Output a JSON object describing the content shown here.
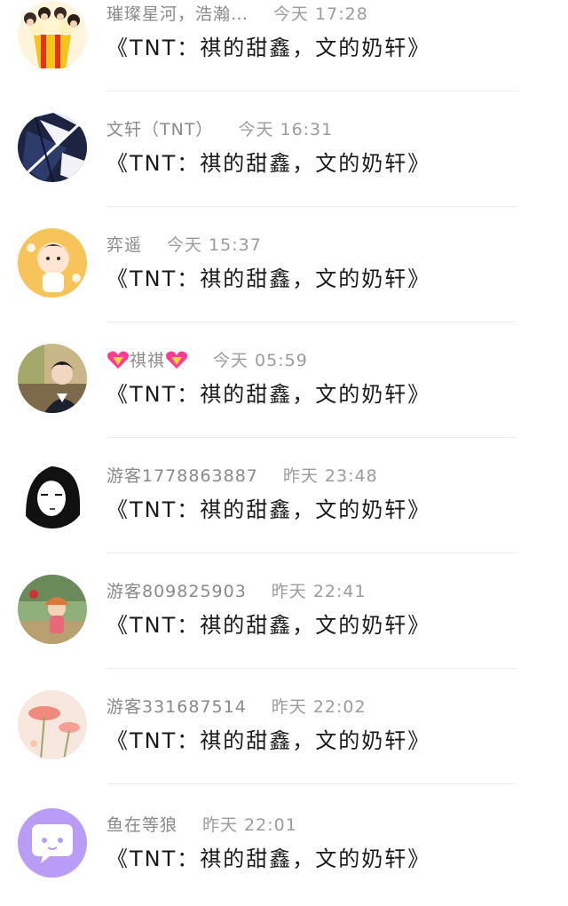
{
  "comments": [
    {
      "name": "璀璨星河，浩瀚…",
      "time": "今天 17:28",
      "text": "《TNT：祺的甜鑫，文的奶轩》",
      "avatar_icon": "popcorn-characters-avatar"
    },
    {
      "name": "文轩（TNT）",
      "time": "今天 16:31",
      "text": "《TNT：祺的甜鑫，文的奶轩》",
      "avatar_icon": "anime-character-dark-avatar"
    },
    {
      "name": "弈遥",
      "time": "今天 15:37",
      "text": "《TNT：祺的甜鑫，文的奶轩》",
      "avatar_icon": "boy-sticker-yellow-avatar"
    },
    {
      "name": "祺祺",
      "time": "今天 05:59",
      "text": "《TNT：祺的甜鑫，文的奶轩》",
      "avatar_icon": "boy-photo-avatar",
      "heart_icons": true
    },
    {
      "name": "游客1778863887",
      "time": "昨天 23:48",
      "text": "《TNT：祺的甜鑫，文的奶轩》",
      "avatar_icon": "manga-girl-avatar"
    },
    {
      "name": "游客809825903",
      "time": "昨天 22:41",
      "text": "《TNT：祺的甜鑫，文的奶轩》",
      "avatar_icon": "cartoon-scene-avatar"
    },
    {
      "name": "游客331687514",
      "time": "昨天 22:02",
      "text": "《TNT：祺的甜鑫，文的奶轩》",
      "avatar_icon": "pink-flower-avatar"
    },
    {
      "name": "鱼在等狼",
      "time": "昨天 22:01",
      "text": "《TNT：祺的甜鑫，文的奶轩》",
      "avatar_icon": "chat-bubble-purple-avatar"
    }
  ]
}
